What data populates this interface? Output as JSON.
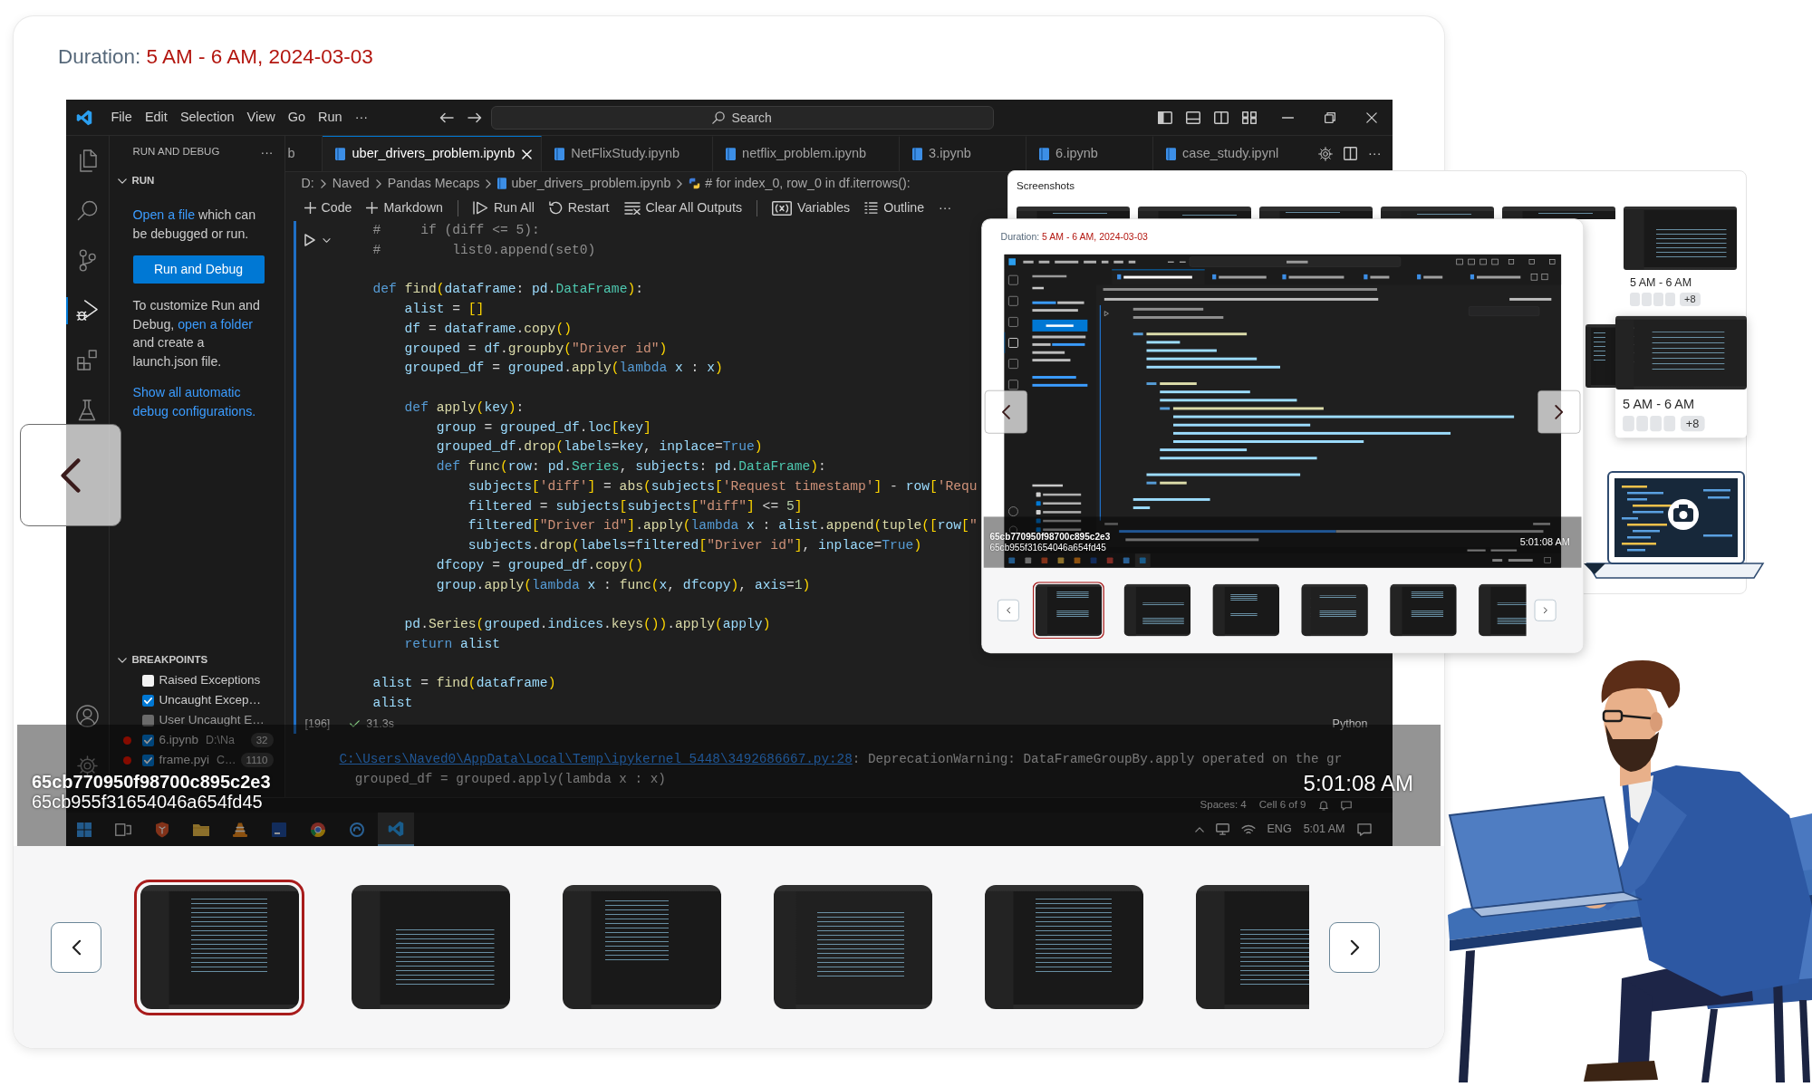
{
  "viewer": {
    "duration": {
      "label": "Duration:",
      "value": "5 AM - 6 AM, 2024-03-03"
    },
    "screenshot": {
      "menus": [
        "File",
        "Edit",
        "Selection",
        "View",
        "Go",
        "Run",
        "···"
      ],
      "search": {
        "placeholder": "Search"
      },
      "activity_bar": [
        {
          "kind": "explorer",
          "selected": false
        },
        {
          "kind": "search",
          "selected": false
        },
        {
          "kind": "source-control",
          "selected": false
        },
        {
          "kind": "run-debug",
          "selected": true
        },
        {
          "kind": "extensions",
          "selected": false
        },
        {
          "kind": "testing",
          "selected": false
        }
      ],
      "sidebar": {
        "title": "RUN AND DEBUG",
        "more": "···",
        "section": "RUN",
        "hint": {
          "link": "Open a file",
          "text": "which can be debugged or run."
        },
        "button": "Run and Debug",
        "customize": {
          "before": "To customize Run and Debug,",
          "link": "open a folder",
          "after": "and create a launch.json file."
        },
        "show_all": "Show all automatic debug configurations.",
        "breakpoints_title": "BREAKPOINTS",
        "breakpoints": [
          {
            "kind": "exception",
            "label": "Raised Exceptions",
            "checked": false,
            "disabled": false
          },
          {
            "kind": "exception",
            "label": "Uncaught Excep…",
            "checked": true,
            "disabled": false
          },
          {
            "kind": "exception",
            "label": "User Uncaught E…",
            "checked": false,
            "disabled": true
          },
          {
            "kind": "file",
            "label": "6.ipynb",
            "path": "D:\\Na",
            "line": "32",
            "checked": true
          },
          {
            "kind": "file",
            "label": "frame.pyi",
            "path": "C…",
            "line": "1110",
            "checked": true
          }
        ]
      },
      "tabs": [
        {
          "kind": "partial",
          "label": "b",
          "selected": false
        },
        {
          "kind": "notebook",
          "label": "uber_drivers_problem.ipynb",
          "selected": true
        },
        {
          "kind": "notebook",
          "label": "NetFlixStudy.ipynb",
          "selected": false
        },
        {
          "kind": "notebook",
          "label": "netflix_problem.ipynb",
          "selected": false
        },
        {
          "kind": "notebook",
          "label": "3.ipynb",
          "selected": false
        },
        {
          "kind": "notebook",
          "label": "6.ipynb",
          "selected": false
        },
        {
          "kind": "notebook",
          "label": "case_study.ipynl",
          "selected": false
        }
      ],
      "tab_more": "···",
      "breadcrumbs": [
        {
          "kind": "folder",
          "label": "D:"
        },
        {
          "kind": "folder",
          "label": "Naved"
        },
        {
          "kind": "folder",
          "label": "Pandas Mecaps"
        },
        {
          "kind": "notebook",
          "label": "uber_drivers_problem.ipynb"
        },
        {
          "kind": "python",
          "label": "# for index_0, row_0 in df.iterrows():"
        }
      ],
      "toolbar": [
        {
          "kind": "add",
          "label": "Code"
        },
        {
          "kind": "add",
          "label": "Markdown"
        },
        {
          "kind": "separator"
        },
        {
          "kind": "run-all",
          "label": "Run All"
        },
        {
          "kind": "restart",
          "label": "Restart"
        },
        {
          "kind": "clear",
          "label": "Clear All Outputs"
        },
        {
          "kind": "separator"
        },
        {
          "kind": "variables",
          "label": "Variables"
        },
        {
          "kind": "outline",
          "label": "Outline"
        },
        {
          "kind": "more",
          "label": "···"
        }
      ],
      "code_blocks": [
        [
          "#     if (diff <= 5):",
          "#         list0.append(set0)"
        ],
        [
          "def find(dataframe: pd.DataFrame):",
          "    alist = []",
          "    df = dataframe.copy()",
          "    grouped = df.groupby(\"Driver id\")",
          "    grouped_df = grouped.apply(lambda x : x)"
        ],
        [
          "    def apply(key):",
          "        group = grouped_df.loc[key]",
          "        grouped_df.drop(labels=key, inplace=True)",
          "        def func(row: pd.Series, subjects: pd.DataFrame):",
          "            subjects['diff'] = abs(subjects['Request timestamp'] - row['Requ",
          "            filtered = subjects[subjects[\"diff\"] <= 5]",
          "            filtered[\"Driver id\"].apply(lambda x : alist.append(tuple([row[\"",
          "            subjects.drop(labels=filtered[\"Driver id\"], inplace=True)",
          "        dfcopy = grouped_df.copy()",
          "        group.apply(lambda x : func(x, dfcopy), axis=1)"
        ],
        [
          "    pd.Series(grouped.indices.keys()).apply(apply)",
          "    return alist"
        ],
        [
          "alist = find(dataframe)",
          "alist"
        ]
      ],
      "cell_footer": {
        "count": "[196]",
        "duration": "31.3s",
        "language": "Python"
      },
      "output": {
        "link": "C:\\Users\\Naved0\\AppData\\Local\\Temp\\ipykernel_5448\\3492686667.py:28",
        "message": ": DeprecationWarning: DataFrameGroupBy.apply operated on the gr",
        "source": "  grouped_df = grouped.apply(lambda x : x)"
      },
      "status_bar": [
        "Spaces: 4",
        "Cell 6 of 9"
      ],
      "taskbar": {
        "apps": [
          {
            "kind": "start",
            "selected": false
          },
          {
            "kind": "task-view",
            "selected": false
          },
          {
            "kind": "shield",
            "selected": false
          },
          {
            "kind": "folder",
            "selected": false
          },
          {
            "kind": "cone",
            "selected": false
          },
          {
            "kind": "ide",
            "selected": false
          },
          {
            "kind": "chrome",
            "selected": false
          },
          {
            "kind": "swirl",
            "selected": false
          },
          {
            "kind": "editor",
            "selected": true
          }
        ],
        "language": "ENG",
        "clock": "5:01 AM"
      }
    },
    "overlay": {
      "ids": [
        "65cb770950f98700c895c2e3",
        "65cb955f31654046a654fd45"
      ],
      "time": "5:01:08 AM"
    },
    "nav_arrows": [
      {
        "kind": "prev"
      }
    ],
    "thumbnails": [
      {
        "selected": true
      },
      {
        "selected": false
      },
      {
        "selected": false
      },
      {
        "selected": false
      },
      {
        "selected": false
      },
      {
        "selected": false
      }
    ]
  },
  "screenshots_panel": {
    "title": "Screenshots",
    "rows": [
      [
        {
          "hovered": false
        },
        {
          "hovered": false
        },
        {
          "hovered": false
        },
        {
          "hovered": false
        },
        {
          "hovered": false
        },
        {
          "hovered": false,
          "label": "5 AM - 6 AM",
          "more": "+8"
        }
      ],
      [
        {
          "hovered": false
        },
        {
          "hovered": true,
          "label": "5 AM - 6 AM",
          "more": "+8"
        }
      ]
    ],
    "viewer": {
      "duration": {
        "label": "Duration:",
        "value": "5 AM - 6 AM, 2024-03-03"
      },
      "overlay": {
        "ids": [
          "65cb770950f98700c895c2e3",
          "65cb955f31654046a654fd45"
        ],
        "time": "5:01:08 AM"
      },
      "nav_arrows": [
        {
          "kind": "prev"
        },
        {
          "kind": "next"
        }
      ],
      "thumbnails": [
        {
          "selected": true
        },
        {
          "selected": false
        },
        {
          "selected": false
        },
        {
          "selected": false
        },
        {
          "selected": false
        },
        {
          "selected": false
        }
      ]
    }
  }
}
